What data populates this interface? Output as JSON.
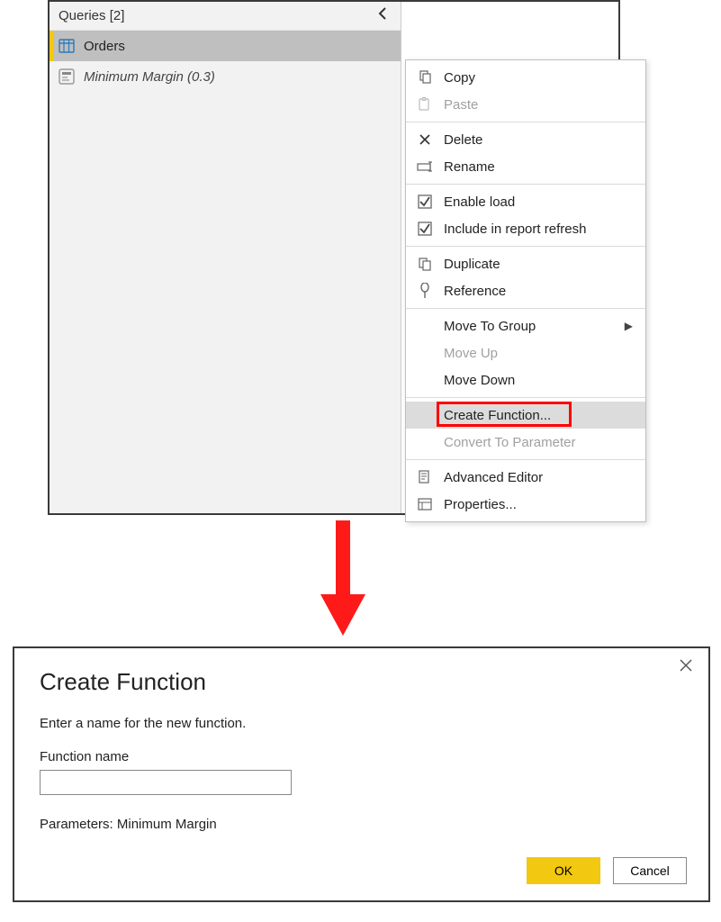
{
  "queriesPanel": {
    "title": "Queries [2]",
    "items": [
      {
        "label": "Orders",
        "selected": true,
        "type": "table"
      },
      {
        "label": "Minimum Margin (0.3)",
        "selected": false,
        "type": "param"
      }
    ]
  },
  "contextMenu": {
    "groups": [
      [
        {
          "label": "Copy",
          "icon": "copy",
          "enabled": true
        },
        {
          "label": "Paste",
          "icon": "paste",
          "enabled": false
        }
      ],
      [
        {
          "label": "Delete",
          "icon": "delete",
          "enabled": true
        },
        {
          "label": "Rename",
          "icon": "rename",
          "enabled": true
        }
      ],
      [
        {
          "label": "Enable load",
          "icon": "check",
          "enabled": true
        },
        {
          "label": "Include in report refresh",
          "icon": "check",
          "enabled": true
        }
      ],
      [
        {
          "label": "Duplicate",
          "icon": "duplicate",
          "enabled": true
        },
        {
          "label": "Reference",
          "icon": "reference",
          "enabled": true
        }
      ],
      [
        {
          "label": "Move To Group",
          "icon": "",
          "enabled": true,
          "submenu": true
        },
        {
          "label": "Move Up",
          "icon": "",
          "enabled": false
        },
        {
          "label": "Move Down",
          "icon": "",
          "enabled": true
        }
      ],
      [
        {
          "label": "Create Function...",
          "icon": "",
          "enabled": true,
          "highlighted": true,
          "hover": true
        },
        {
          "label": "Convert To Parameter",
          "icon": "",
          "enabled": false
        }
      ],
      [
        {
          "label": "Advanced Editor",
          "icon": "editor",
          "enabled": true
        },
        {
          "label": "Properties...",
          "icon": "properties",
          "enabled": true
        }
      ]
    ]
  },
  "dialog": {
    "title": "Create Function",
    "prompt": "Enter a name for the new function.",
    "fieldLabel": "Function name",
    "fieldValue": "",
    "paramsLine": "Parameters: Minimum Margin",
    "okLabel": "OK",
    "cancelLabel": "Cancel"
  }
}
